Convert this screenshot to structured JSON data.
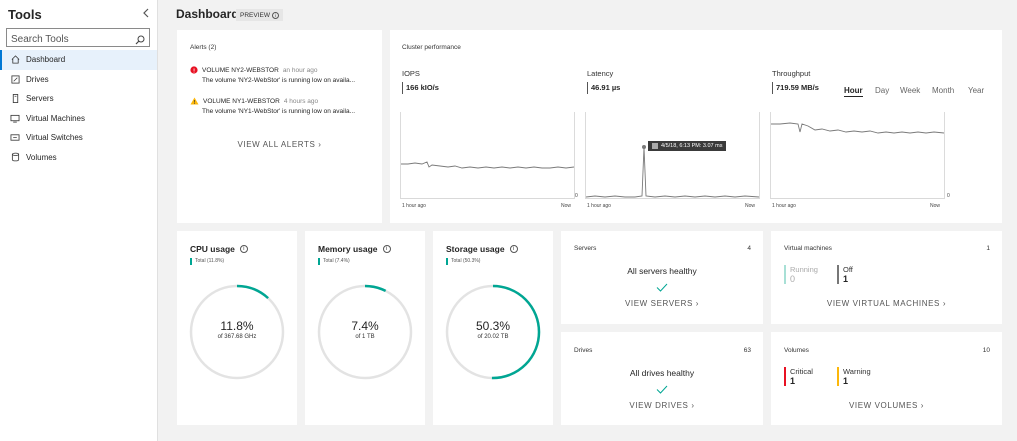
{
  "sidebar": {
    "title": "Tools",
    "search_placeholder": "Search Tools",
    "items": [
      {
        "label": "Dashboard"
      },
      {
        "label": "Drives"
      },
      {
        "label": "Servers"
      },
      {
        "label": "Virtual Machines"
      },
      {
        "label": "Virtual Switches"
      },
      {
        "label": "Volumes"
      }
    ]
  },
  "header": {
    "title": "Dashboard",
    "badge": "PREVIEW"
  },
  "alerts": {
    "title": "Alerts (2)",
    "items": [
      {
        "severity": "error",
        "title": "VOLUME NY2-WEBSTOR",
        "time": "an hour ago",
        "desc": "The volume 'NY2-WebStor' is running low on availa..."
      },
      {
        "severity": "warning",
        "title": "VOLUME NY1-WEBSTOR",
        "time": "4 hours ago",
        "desc": "The volume 'NY1-WebStor' is running low on availa..."
      }
    ],
    "view_all": "VIEW ALL ALERTS"
  },
  "performance": {
    "title": "Cluster performance",
    "tabs": [
      "Hour",
      "Day",
      "Week",
      "Month",
      "Year"
    ],
    "active_tab": "Hour",
    "metrics": [
      {
        "label": "IOPS",
        "value": "166 kIO/s",
        "x_start": "1 hour ago",
        "x_end": "Now"
      },
      {
        "label": "Latency",
        "value": "46.91 µs",
        "x_start": "1 hour ago",
        "x_end": "Now",
        "y_zero": "0",
        "tooltip": "4/5/18, 6:13 PM: 3.07 ms"
      },
      {
        "label": "Throughput",
        "value": "719.59 MB/s",
        "x_start": "1 hour ago",
        "x_end": "Now",
        "y_zero": "0"
      }
    ]
  },
  "usage": {
    "cpu": {
      "title": "CPU usage",
      "legend": "Total (11.8%)",
      "pct": "11.8%",
      "sub": "of 367.68 GHz",
      "fraction": 0.118
    },
    "memory": {
      "title": "Memory usage",
      "legend": "Total (7.4%)",
      "pct": "7.4%",
      "sub": "of 1 TB",
      "fraction": 0.074
    },
    "storage": {
      "title": "Storage usage",
      "legend": "Total (50.3%)",
      "pct": "50.3%",
      "sub": "of 20.02 TB",
      "fraction": 0.503
    }
  },
  "servers": {
    "title": "Servers",
    "count": "4",
    "status": "All servers healthy",
    "link": "VIEW SERVERS"
  },
  "drives": {
    "title": "Drives",
    "count": "63",
    "status": "All drives healthy",
    "link": "VIEW DRIVES"
  },
  "vms": {
    "title": "Virtual machines",
    "count": "1",
    "running_label": "Running",
    "running_value": "0",
    "off_label": "Off",
    "off_value": "1",
    "link": "VIEW VIRTUAL MACHINES"
  },
  "volumes": {
    "title": "Volumes",
    "count": "10",
    "critical_label": "Critical",
    "critical_value": "1",
    "warning_label": "Warning",
    "warning_value": "1",
    "link": "VIEW VOLUMES"
  },
  "colors": {
    "accent": "#0078d4",
    "teal": "#00a693",
    "error": "#e81123",
    "warning": "#fcb70a",
    "critical": "#e81123"
  }
}
